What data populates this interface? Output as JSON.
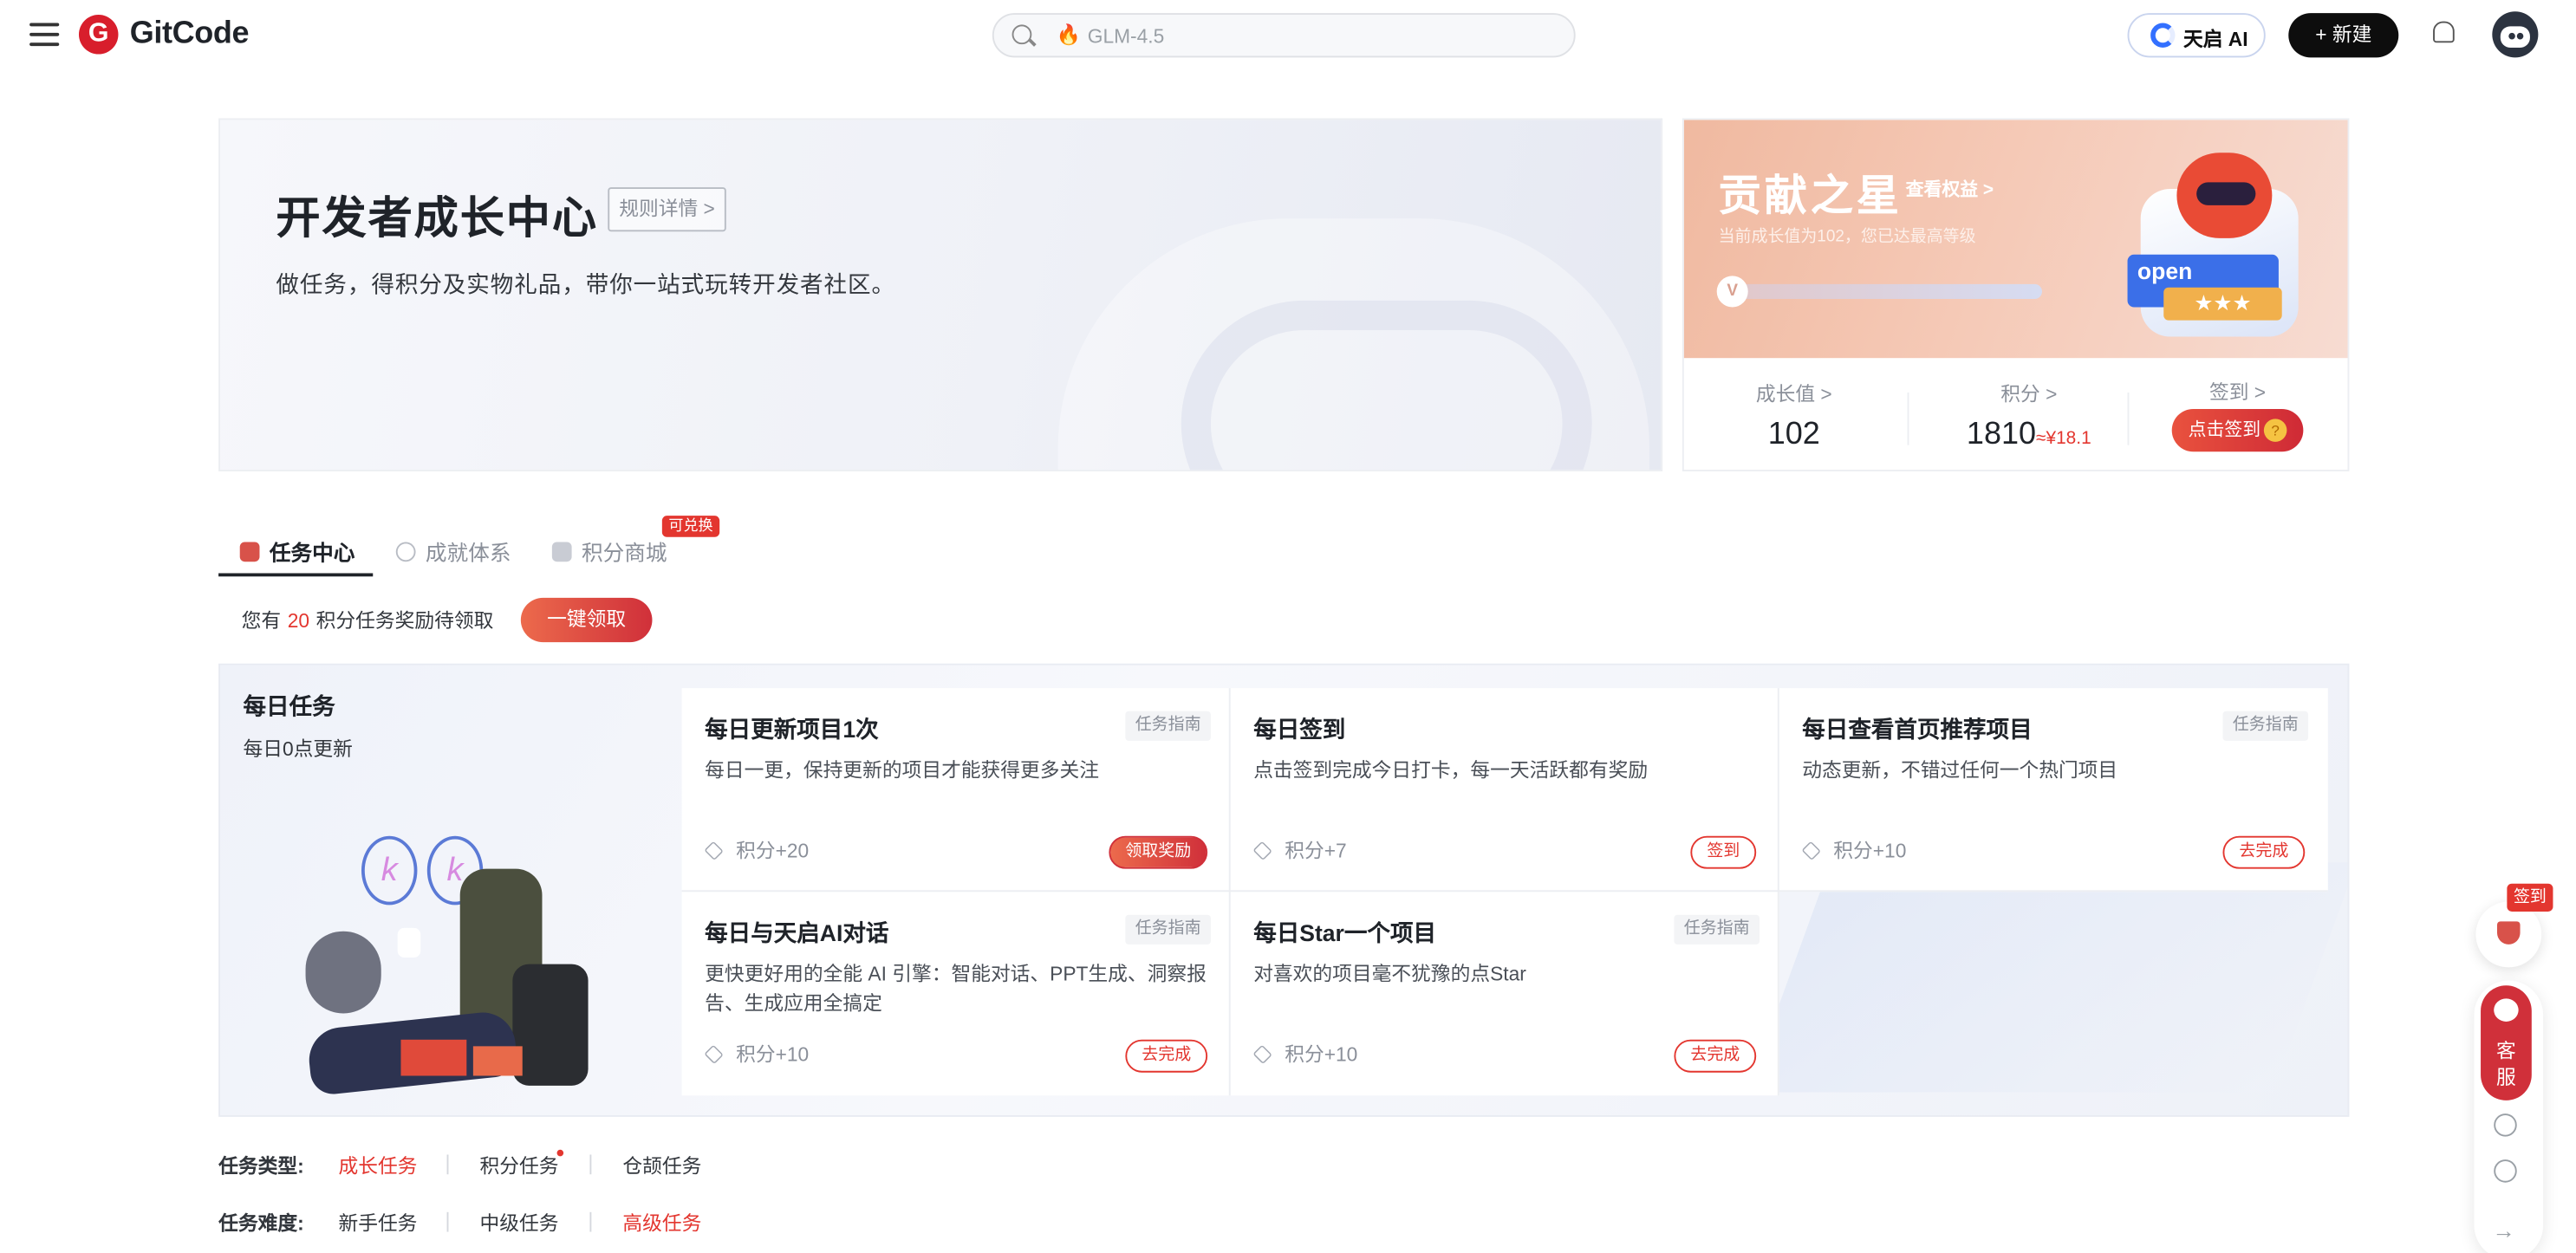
{
  "header": {
    "logo_letter": "G",
    "logo_text": "GitCode",
    "search_placeholder": "GLM-4.5",
    "tianqi_label": "天启 AI",
    "new_label": "+ 新建"
  },
  "banner": {
    "title": "开发者成长中心",
    "rules_label": "规则详情 >",
    "description": "做任务，得积分及实物礼品，带你一站式玩转开发者社区。"
  },
  "star_card": {
    "title": "贡献之星",
    "link": "查看权益 >",
    "subtitle": "当前成长值为102，您已达最高等级",
    "level_badge": "V",
    "progress_fraction": 1.0,
    "mascot_ribbon": "open",
    "mascot_stars": "★★★",
    "stats": {
      "growth_label": "成长值 >",
      "growth_value": "102",
      "points_label": "积分 >",
      "points_value": "1810",
      "points_cny": "≈¥18.1",
      "signin_label": "签到 >",
      "signin_button": "点击签到",
      "signin_coin": "?"
    }
  },
  "tabs": [
    {
      "label": "任务中心",
      "active": true
    },
    {
      "label": "成就体系",
      "active": false
    },
    {
      "label": "积分商城",
      "active": false,
      "badge": "可兑换"
    }
  ],
  "reward": {
    "prefix": "您有",
    "count": "20",
    "suffix": "积分任务奖励待领取",
    "claim_all": "一键领取"
  },
  "daily": {
    "title": "每日任务",
    "subtitle": "每日0点更新",
    "tasks": [
      {
        "title": "每日更新项目1次",
        "guide": "任务指南",
        "desc": "每日一更，保持更新的项目才能获得更多关注",
        "points": "积分+20",
        "action": "领取奖励"
      },
      {
        "title": "每日签到",
        "guide": "",
        "desc": "点击签到完成今日打卡，每一天活跃都有奖励",
        "points": "积分+7",
        "action": "签到"
      },
      {
        "title": "每日查看首页推荐项目",
        "guide": "任务指南",
        "desc": "动态更新，不错过任何一个热门项目",
        "points": "积分+10",
        "action": "去完成"
      },
      {
        "title": "每日与天启AI对话",
        "guide": "任务指南",
        "desc": "更快更好用的全能 AI 引擎：智能对话、PPT生成、洞察报告、生成应用全搞定",
        "points": "积分+10",
        "action": "去完成"
      },
      {
        "title": "每日Star一个项目",
        "guide": "任务指南",
        "desc": "对喜欢的项目毫不犹豫的点Star",
        "points": "积分+10",
        "action": "去完成"
      }
    ]
  },
  "filters": {
    "type_label": "任务类型:",
    "types": [
      "成长任务",
      "积分任务",
      "仓颉任务"
    ],
    "type_selected": "成长任务",
    "difficulty_label": "任务难度:",
    "difficulties": [
      "新手任务",
      "中级任务",
      "高级任务"
    ],
    "difficulty_selected": "高级任务"
  },
  "floating": {
    "sign_tag": "签到",
    "kefu_line1": "客",
    "kefu_line2": "服",
    "arrow": "→"
  },
  "colors": {
    "accent_red": "#e3362f",
    "brand_red": "#d81e2c",
    "star_card_bg": "#f0b9a0"
  }
}
